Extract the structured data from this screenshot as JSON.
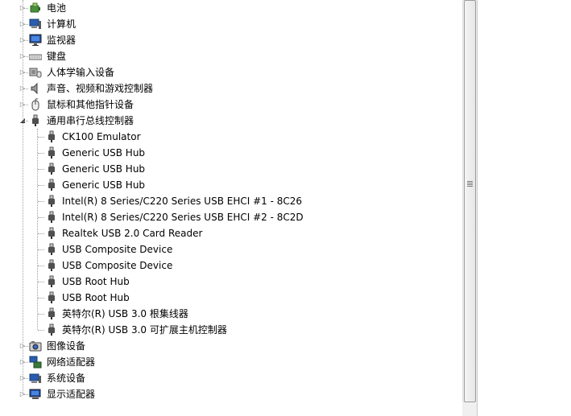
{
  "categories_top": [
    {
      "label": "电池",
      "icon": "battery-icon"
    },
    {
      "label": "计算机",
      "icon": "computer-icon"
    },
    {
      "label": "监视器",
      "icon": "monitor-icon"
    },
    {
      "label": "键盘",
      "icon": "keyboard-icon"
    },
    {
      "label": "人体学输入设备",
      "icon": "hid-icon"
    },
    {
      "label": "声音、视频和游戏控制器",
      "icon": "speaker-icon"
    },
    {
      "label": "鼠标和其他指针设备",
      "icon": "mouse-icon"
    }
  ],
  "usb_category": {
    "label": "通用串行总线控制器",
    "icon": "usb-icon"
  },
  "usb_devices": [
    "CK100 Emulator",
    "Generic USB Hub",
    "Generic USB Hub",
    "Generic USB Hub",
    "Intel(R) 8 Series/C220 Series USB EHCI #1 - 8C26",
    "Intel(R) 8 Series/C220 Series USB EHCI #2 - 8C2D",
    "Realtek USB 2.0 Card Reader",
    "USB Composite Device",
    "USB Composite Device",
    "USB Root Hub",
    "USB Root Hub",
    "英特尔(R) USB 3.0 根集线器",
    "英特尔(R) USB 3.0 可扩展主机控制器"
  ],
  "categories_bottom": [
    {
      "label": "图像设备",
      "icon": "camera-icon"
    },
    {
      "label": "网络适配器",
      "icon": "network-adapter-icon"
    },
    {
      "label": "系统设备",
      "icon": "system-device-icon"
    },
    {
      "label": "显示适配器",
      "icon": "display-adapter-icon"
    }
  ]
}
